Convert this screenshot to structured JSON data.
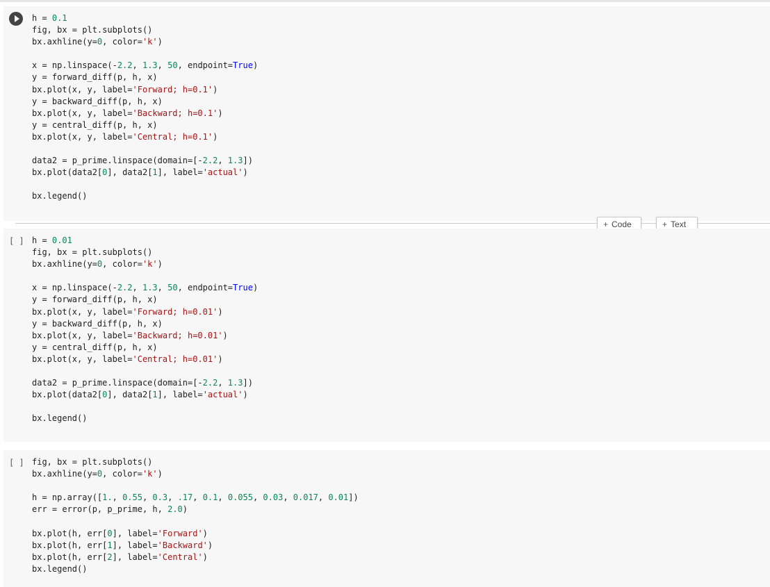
{
  "toolbar": {
    "add_code_label": "Code",
    "add_text_label": "Text",
    "plus": "+"
  },
  "cells": [
    {
      "status": "run",
      "lines": [
        [
          {
            "t": "h = "
          },
          {
            "t": "0.1",
            "c": "num"
          }
        ],
        [
          {
            "t": "fig, bx = plt.subplots()"
          }
        ],
        [
          {
            "t": "bx.axhline(y="
          },
          {
            "t": "0",
            "c": "num"
          },
          {
            "t": ", color="
          },
          {
            "t": "'k'",
            "c": "str"
          },
          {
            "t": ")"
          }
        ],
        [],
        [
          {
            "t": "x = np.linspace(-"
          },
          {
            "t": "2.2",
            "c": "num"
          },
          {
            "t": ", "
          },
          {
            "t": "1.3",
            "c": "num"
          },
          {
            "t": ", "
          },
          {
            "t": "50",
            "c": "num"
          },
          {
            "t": ", endpoint="
          },
          {
            "t": "True",
            "c": "kw"
          },
          {
            "t": ")"
          }
        ],
        [
          {
            "t": "y = forward_diff(p, h, x)"
          }
        ],
        [
          {
            "t": "bx.plot(x, y, label="
          },
          {
            "t": "'Forward; h=0.1'",
            "c": "str"
          },
          {
            "t": ")"
          }
        ],
        [
          {
            "t": "y = backward_diff(p, h, x)"
          }
        ],
        [
          {
            "t": "bx.plot(x, y, label="
          },
          {
            "t": "'Backward; h=0.1'",
            "c": "str"
          },
          {
            "t": ")"
          }
        ],
        [
          {
            "t": "y = central_diff(p, h, x)"
          }
        ],
        [
          {
            "t": "bx.plot(x, y, label="
          },
          {
            "t": "'Central; h=0.1'",
            "c": "str"
          },
          {
            "t": ")"
          }
        ],
        [],
        [
          {
            "t": "data2 = p_prime.linspace(domain=[-"
          },
          {
            "t": "2.2",
            "c": "num"
          },
          {
            "t": ", "
          },
          {
            "t": "1.3",
            "c": "num"
          },
          {
            "t": "])"
          }
        ],
        [
          {
            "t": "bx.plot(data2["
          },
          {
            "t": "0",
            "c": "num"
          },
          {
            "t": "], data2["
          },
          {
            "t": "1",
            "c": "num"
          },
          {
            "t": "], label="
          },
          {
            "t": "'actual'",
            "c": "str"
          },
          {
            "t": ")"
          }
        ],
        [],
        [
          {
            "t": "bx.legend()"
          }
        ]
      ]
    },
    {
      "status": "[ ]",
      "lines": [
        [
          {
            "t": "h = "
          },
          {
            "t": "0.01",
            "c": "num"
          }
        ],
        [
          {
            "t": "fig, bx = plt.subplots()"
          }
        ],
        [
          {
            "t": "bx.axhline(y="
          },
          {
            "t": "0",
            "c": "num"
          },
          {
            "t": ", color="
          },
          {
            "t": "'k'",
            "c": "str"
          },
          {
            "t": ")"
          }
        ],
        [],
        [
          {
            "t": "x = np.linspace(-"
          },
          {
            "t": "2.2",
            "c": "num"
          },
          {
            "t": ", "
          },
          {
            "t": "1.3",
            "c": "num"
          },
          {
            "t": ", "
          },
          {
            "t": "50",
            "c": "num"
          },
          {
            "t": ", endpoint="
          },
          {
            "t": "True",
            "c": "kw"
          },
          {
            "t": ")"
          }
        ],
        [
          {
            "t": "y = forward_diff(p, h, x)"
          }
        ],
        [
          {
            "t": "bx.plot(x, y, label="
          },
          {
            "t": "'Forward; h=0.01'",
            "c": "str"
          },
          {
            "t": ")"
          }
        ],
        [
          {
            "t": "y = backward_diff(p, h, x)"
          }
        ],
        [
          {
            "t": "bx.plot(x, y, label="
          },
          {
            "t": "'Backward; h=0.01'",
            "c": "str"
          },
          {
            "t": ")"
          }
        ],
        [
          {
            "t": "y = central_diff(p, h, x)"
          }
        ],
        [
          {
            "t": "bx.plot(x, y, label="
          },
          {
            "t": "'Central; h=0.01'",
            "c": "str"
          },
          {
            "t": ")"
          }
        ],
        [],
        [
          {
            "t": "data2 = p_prime.linspace(domain=[-"
          },
          {
            "t": "2.2",
            "c": "num"
          },
          {
            "t": ", "
          },
          {
            "t": "1.3",
            "c": "num"
          },
          {
            "t": "])"
          }
        ],
        [
          {
            "t": "bx.plot(data2["
          },
          {
            "t": "0",
            "c": "num"
          },
          {
            "t": "], data2["
          },
          {
            "t": "1",
            "c": "num"
          },
          {
            "t": "], label="
          },
          {
            "t": "'actual'",
            "c": "str"
          },
          {
            "t": ")"
          }
        ],
        [],
        [
          {
            "t": "bx.legend()"
          }
        ]
      ]
    },
    {
      "status": "[ ]",
      "lines": [
        [
          {
            "t": "fig, bx = plt.subplots()"
          }
        ],
        [
          {
            "t": "bx.axhline(y="
          },
          {
            "t": "0",
            "c": "num"
          },
          {
            "t": ", color="
          },
          {
            "t": "'k'",
            "c": "str"
          },
          {
            "t": ")"
          }
        ],
        [],
        [
          {
            "t": "h = np.array(["
          },
          {
            "t": "1.",
            "c": "num"
          },
          {
            "t": ", "
          },
          {
            "t": "0.55",
            "c": "num"
          },
          {
            "t": ", "
          },
          {
            "t": "0.3",
            "c": "num"
          },
          {
            "t": ", "
          },
          {
            "t": ".17",
            "c": "num"
          },
          {
            "t": ", "
          },
          {
            "t": "0.1",
            "c": "num"
          },
          {
            "t": ", "
          },
          {
            "t": "0.055",
            "c": "num"
          },
          {
            "t": ", "
          },
          {
            "t": "0.03",
            "c": "num"
          },
          {
            "t": ", "
          },
          {
            "t": "0.017",
            "c": "num"
          },
          {
            "t": ", "
          },
          {
            "t": "0.01",
            "c": "num"
          },
          {
            "t": "])"
          }
        ],
        [
          {
            "t": "err = error(p, p_prime, h, "
          },
          {
            "t": "2.0",
            "c": "num"
          },
          {
            "t": ")"
          }
        ],
        [],
        [
          {
            "t": "bx.plot(h, err["
          },
          {
            "t": "0",
            "c": "num"
          },
          {
            "t": "], label="
          },
          {
            "t": "'Forward'",
            "c": "str"
          },
          {
            "t": ")"
          }
        ],
        [
          {
            "t": "bx.plot(h, err["
          },
          {
            "t": "1",
            "c": "num"
          },
          {
            "t": "], label="
          },
          {
            "t": "'Backward'",
            "c": "str"
          },
          {
            "t": ")"
          }
        ],
        [
          {
            "t": "bx.plot(h, err["
          },
          {
            "t": "2",
            "c": "num"
          },
          {
            "t": "], label="
          },
          {
            "t": "'Central'",
            "c": "str"
          },
          {
            "t": ")"
          }
        ],
        [
          {
            "t": "bx.legend()"
          }
        ]
      ]
    }
  ],
  "colors": {
    "number": "#098658",
    "string": "#a31515",
    "keyword": "#0000ff",
    "cell_bg": "#f7f7f7"
  }
}
